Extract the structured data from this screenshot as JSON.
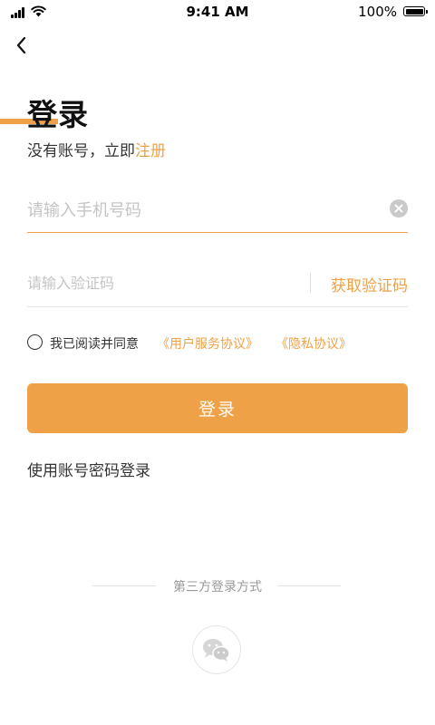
{
  "status_bar": {
    "time": "9:41 AM",
    "battery": "100%",
    "icons": [
      "signal-icon",
      "wifi-icon",
      "battery-icon"
    ]
  },
  "nav": {
    "back_icon": "chevron-left-icon"
  },
  "header": {
    "title": "登录",
    "prompt": "没有账号，立即",
    "register_link": "注册"
  },
  "phone_field": {
    "placeholder": "请输入手机号码",
    "value": "",
    "clear_icon": "close-circle-icon"
  },
  "code_field": {
    "placeholder": "请输入验证码",
    "value": "",
    "get_code_label": "获取验证码"
  },
  "agreement": {
    "checked": false,
    "text": "我已阅读并同意",
    "user_agreement": "《用户服务协议》",
    "privacy_policy": "《隐私协议》"
  },
  "login_button_label": "登录",
  "password_login_label": "使用账号密码登录",
  "third_party": {
    "label": "第三方登录方式",
    "icon": "wechat-icon"
  },
  "colors": {
    "accent": "#eea147",
    "placeholder": "#c4c4c4",
    "text": "#333333"
  }
}
